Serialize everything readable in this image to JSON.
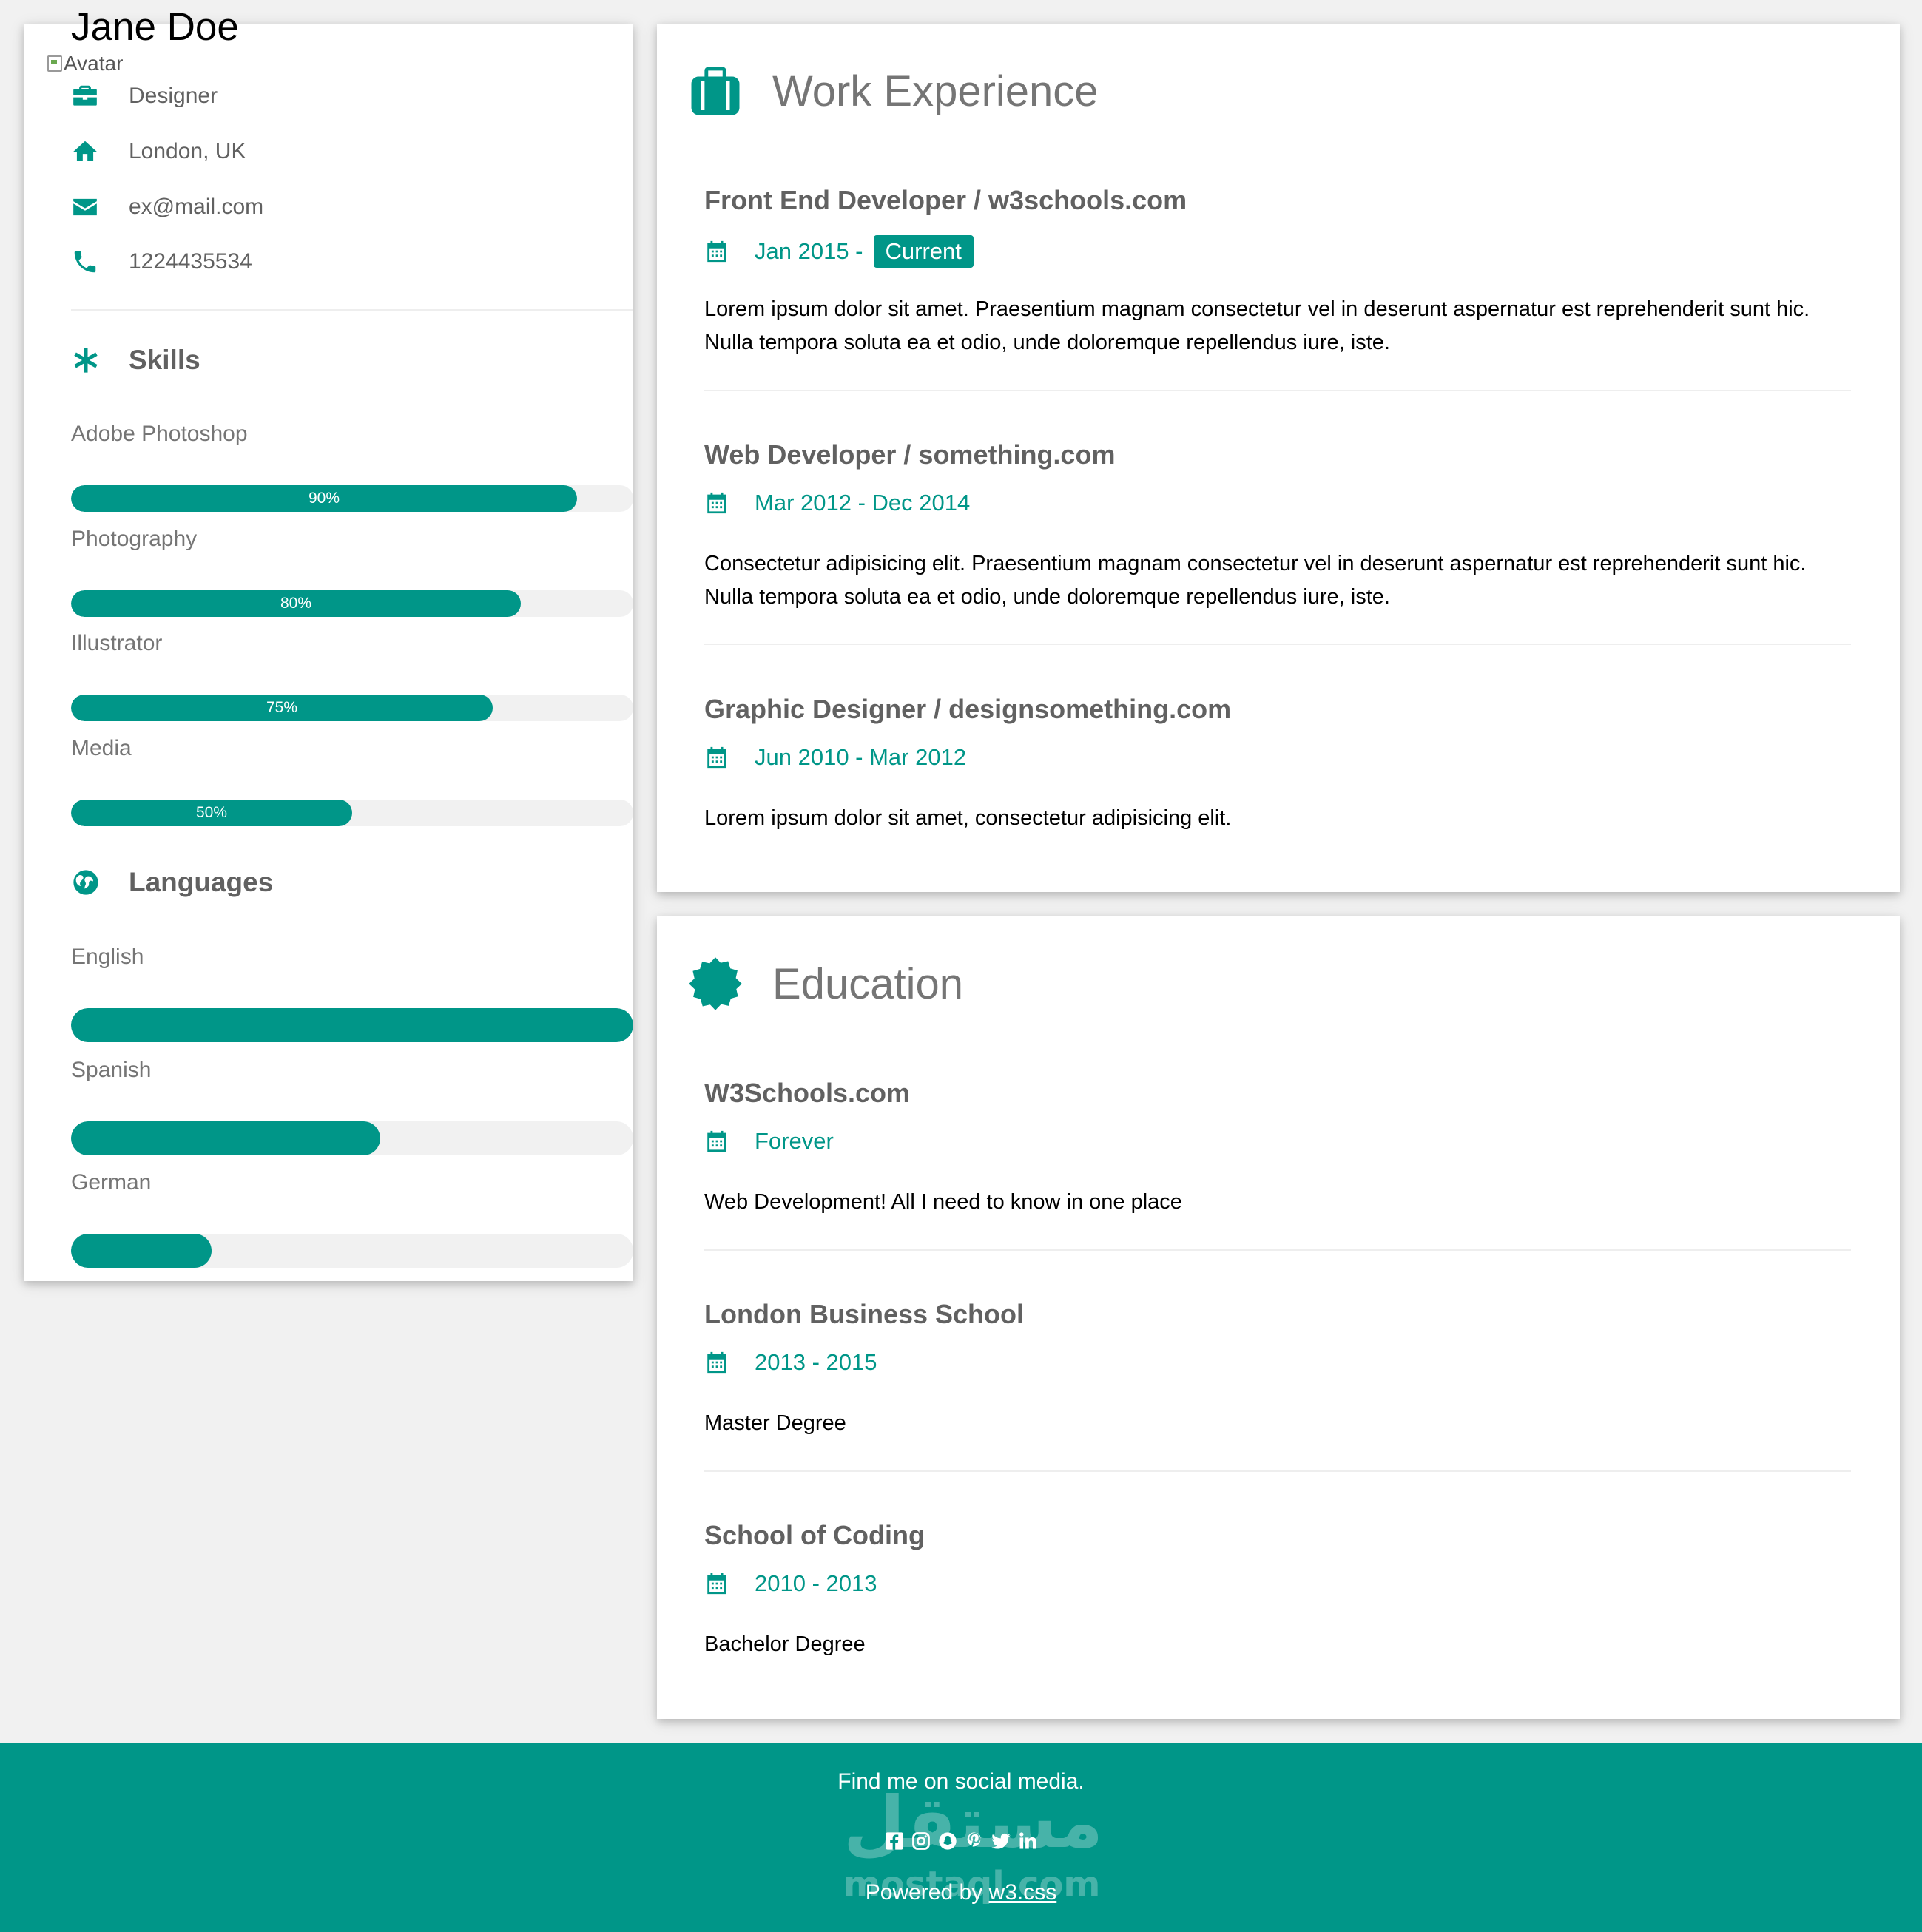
{
  "profile": {
    "name": "Jane Doe",
    "avatar_alt": "Avatar",
    "job": "Designer",
    "location": "London, UK",
    "email": "ex@mail.com",
    "phone": "1224435534"
  },
  "skills": {
    "heading": "Skills",
    "items": [
      {
        "label": "Adobe Photoshop",
        "percent": 90,
        "display": "90%"
      },
      {
        "label": "Photography",
        "percent": 80,
        "display": "80%"
      },
      {
        "label": "Illustrator",
        "percent": 75,
        "display": "75%"
      },
      {
        "label": "Media",
        "percent": 50,
        "display": "50%"
      }
    ]
  },
  "languages": {
    "heading": "Languages",
    "items": [
      {
        "label": "English",
        "percent": 100
      },
      {
        "label": "Spanish",
        "percent": 55
      },
      {
        "label": "German",
        "percent": 25
      }
    ]
  },
  "work": {
    "heading": "Work Experience",
    "entries": [
      {
        "title": "Front End Developer / w3schools.com",
        "date": "Jan 2015 -",
        "badge": "Current",
        "desc": "Lorem ipsum dolor sit amet. Praesentium magnam consectetur vel in deserunt aspernatur est reprehenderit sunt hic. Nulla tempora soluta ea et odio, unde doloremque repellendus iure, iste."
      },
      {
        "title": "Web Developer / something.com",
        "date": "Mar 2012 - Dec 2014",
        "desc": "Consectetur adipisicing elit. Praesentium magnam consectetur vel in deserunt aspernatur est reprehenderit sunt hic. Nulla tempora soluta ea et odio, unde doloremque repellendus iure, iste."
      },
      {
        "title": "Graphic Designer / designsomething.com",
        "date": "Jun 2010 - Mar 2012",
        "desc": "Lorem ipsum dolor sit amet, consectetur adipisicing elit."
      }
    ]
  },
  "education": {
    "heading": "Education",
    "entries": [
      {
        "title": "W3Schools.com",
        "date": "Forever",
        "desc": "Web Development! All I need to know in one place"
      },
      {
        "title": "London Business School",
        "date": "2013 - 2015",
        "desc": "Master Degree"
      },
      {
        "title": "School of Coding",
        "date": "2010 - 2013",
        "desc": "Bachelor Degree"
      }
    ]
  },
  "footer": {
    "find": "Find me on social media.",
    "powered_prefix": "Powered by",
    "powered_link": "w3.css",
    "socials": [
      "facebook-icon",
      "instagram-icon",
      "snapchat-icon",
      "pinterest-icon",
      "twitter-icon",
      "linkedin-icon"
    ]
  },
  "watermark": {
    "arabic": "مستقل",
    "latin": "mostaql.com"
  },
  "colors": {
    "accent": "#009688",
    "background": "#f1f1f1",
    "track": "#f1f1f1"
  }
}
